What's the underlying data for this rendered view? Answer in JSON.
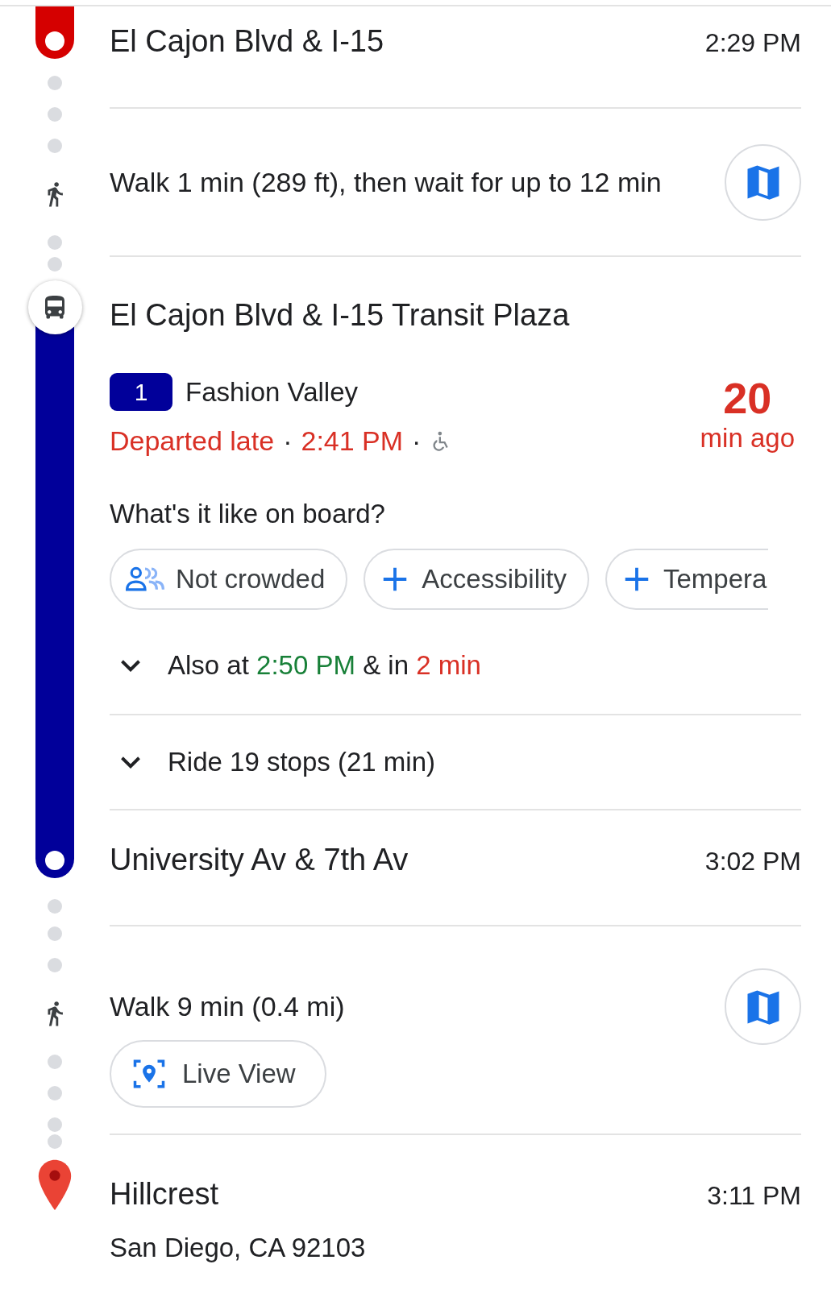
{
  "origin": {
    "name": "El Cajon Blvd & I-15",
    "time": "2:29 PM"
  },
  "walk_1": {
    "text": "Walk 1 min (289 ft), then wait for up to 12 min"
  },
  "boarding": {
    "stop": "El Cajon Blvd & I-15 Transit Plaza",
    "route": {
      "number": "1",
      "color": "#01009a",
      "headsign": "Fashion Valley"
    },
    "status_line": [
      {
        "text": "Departed late",
        "color": "#d93025"
      },
      {
        "text": "·",
        "color": "#202124"
      },
      {
        "text": "2:41 PM",
        "color": "#d93025"
      },
      {
        "text": "·",
        "color": "#202124"
      }
    ],
    "wheelchair_accessible": true,
    "countdown": {
      "value": "20",
      "unit": "min ago"
    },
    "prompt": "What's it like on board?",
    "chips": [
      {
        "kind": "crowding",
        "label": "Not crowded"
      },
      {
        "kind": "add",
        "label": "Accessibility"
      },
      {
        "kind": "add",
        "label": "Tempera"
      }
    ],
    "also_at": {
      "expanded": false,
      "parts": [
        {
          "text": "Also at ",
          "color": "#202124"
        },
        {
          "text": "2:50 PM",
          "color": "#188038"
        },
        {
          "text": " & in ",
          "color": "#202124"
        },
        {
          "text": "2 min",
          "color": "#d93025"
        }
      ]
    }
  },
  "ride": {
    "text": "Ride 19 stops (21 min)",
    "expanded": false
  },
  "alight": {
    "name": "University Av & 7th Av",
    "time": "3:02 PM"
  },
  "walk_2": {
    "text": "Walk 9 min (0.4 mi)",
    "live_view": "Live View"
  },
  "destination": {
    "name": "Hillcrest",
    "time": "3:11 PM",
    "address": "San Diego, CA 92103"
  }
}
